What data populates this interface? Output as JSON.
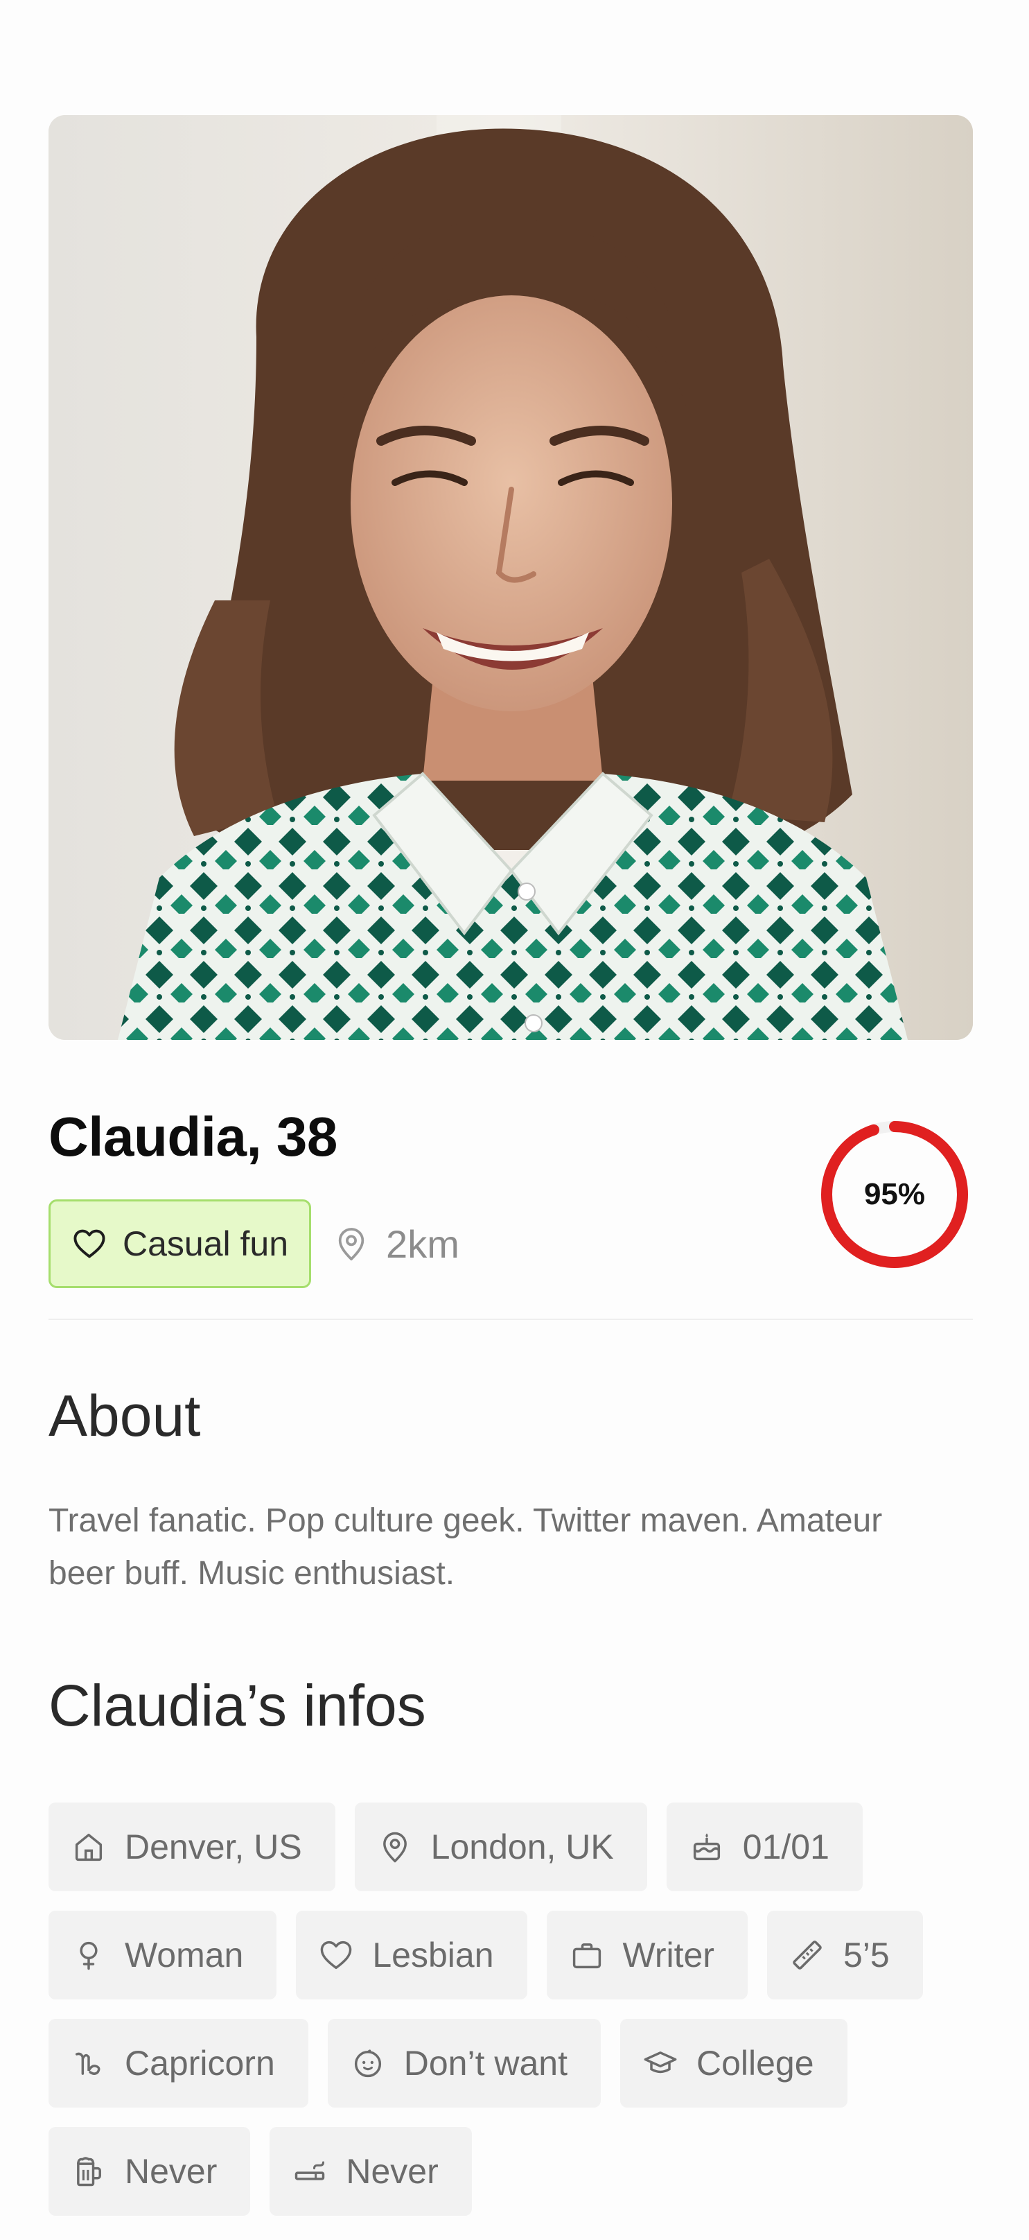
{
  "profile": {
    "name_age": "Claudia, 38",
    "intent": "Casual fun",
    "distance": "2km",
    "match_percent_label": "95%",
    "match_value": 0.95
  },
  "about": {
    "title": "About",
    "text": "Travel fanatic. Pop culture geek. Twitter maven. Amateur beer buff. Music enthusiast."
  },
  "infos": {
    "title": "Claudia’s infos",
    "chips": [
      {
        "icon": "home-icon",
        "label": "Denver, US"
      },
      {
        "icon": "location-pin-icon",
        "label": "London, UK"
      },
      {
        "icon": "birthday-cake-icon",
        "label": "01/01"
      },
      {
        "icon": "female-symbol-icon",
        "label": "Woman"
      },
      {
        "icon": "heart-icon",
        "label": "Lesbian"
      },
      {
        "icon": "briefcase-icon",
        "label": "Writer"
      },
      {
        "icon": "ruler-icon",
        "label": "5’5"
      },
      {
        "icon": "capricorn-icon",
        "label": "Capricorn"
      },
      {
        "icon": "baby-face-icon",
        "label": "Don’t want"
      },
      {
        "icon": "graduation-cap-icon",
        "label": "College"
      },
      {
        "icon": "beer-mug-icon",
        "label": "Never"
      },
      {
        "icon": "cigarette-icon",
        "label": "Never"
      }
    ]
  },
  "colors": {
    "accent_green_bg": "#e6f9c9",
    "accent_green_border": "#a5de6c",
    "match_ring": "#e02020"
  }
}
